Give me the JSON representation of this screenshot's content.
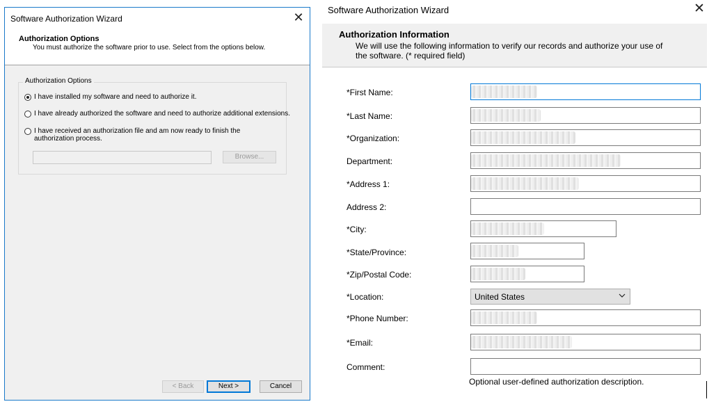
{
  "left_window": {
    "title": "Software Authorization Wizard",
    "header_title": "Authorization Options",
    "header_subtitle": "You must authorize the software prior to use. Select from the options below.",
    "group_label": "Authorization Options",
    "options": [
      {
        "label": "I have installed my software and need to authorize it.",
        "selected": true
      },
      {
        "label": "I have already authorized the software and need to authorize additional extensions.",
        "selected": false
      },
      {
        "label": "I have received an authorization file and am now ready to finish the authorization process.",
        "selected": false
      }
    ],
    "browse_label": "Browse...",
    "back_label": "< Back",
    "next_label": "Next >",
    "cancel_label": "Cancel"
  },
  "right_window": {
    "title": "Software Authorization Wizard",
    "header_title": "Authorization Information",
    "header_subtitle": "We will use the following information to verify our records and authorize your use of the software. (* required field)",
    "fields": {
      "first_name": "*First Name:",
      "last_name": "*Last Name:",
      "organization": "*Organization:",
      "department": "Department:",
      "address1": "*Address 1:",
      "address2": "Address 2:",
      "city": "*City:",
      "state": "*State/Province:",
      "zip": "*Zip/Postal Code:",
      "location": "*Location:",
      "phone": "*Phone Number:",
      "email": "*Email:",
      "comment": "Comment:"
    },
    "location_value": "United States",
    "comment_hint": "Optional user-defined authorization description."
  },
  "icons": {
    "close": "close-icon",
    "dropdown": "chevron-down-icon"
  },
  "colors": {
    "focus_border": "#0078d7",
    "window_border": "#1979ca",
    "dialog_background": "#f0f0f0"
  }
}
